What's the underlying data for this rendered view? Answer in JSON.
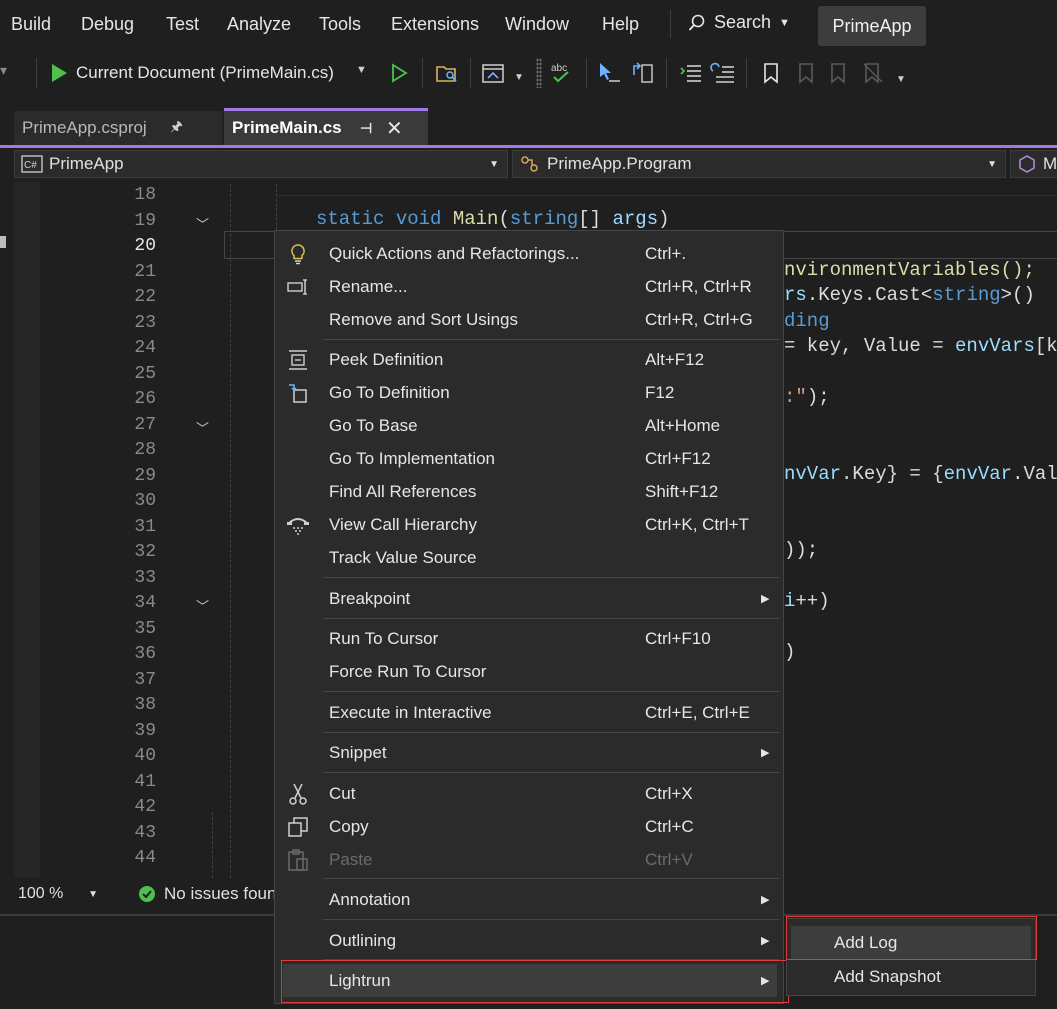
{
  "menubar": {
    "items": [
      "Build",
      "Debug",
      "Test",
      "Analyze",
      "Tools",
      "Extensions",
      "Window",
      "Help"
    ],
    "search_label": "Search",
    "solution_name": "PrimeApp"
  },
  "toolbar": {
    "run_target": "Current Document (PrimeMain.cs)"
  },
  "tabs": [
    {
      "label": "PrimeApp.csproj",
      "active": false
    },
    {
      "label": "PrimeMain.cs",
      "active": true
    }
  ],
  "navbar": {
    "project": "PrimeApp",
    "class": "PrimeApp.Program",
    "member": "M"
  },
  "editor": {
    "line_numbers": [
      "18",
      "19",
      "20",
      "21",
      "22",
      "23",
      "24",
      "25",
      "26",
      "27",
      "28",
      "29",
      "30",
      "31",
      "32",
      "33",
      "34",
      "35",
      "36",
      "37",
      "38",
      "39",
      "40",
      "41",
      "42",
      "43",
      "44"
    ],
    "current_line": "20",
    "code": {
      "l19_kw1": "static",
      "l19_kw2": "void",
      "l19_method": "Main",
      "l19_p1": "(",
      "l19_type": "string",
      "l19_p2": "[] ",
      "l19_param": "args",
      "l19_p3": ")",
      "l21": "nvironmentVariables();",
      "l22_a": "rs",
      "l22_b": ".Keys.Cast<",
      "l22_c": "string",
      "l22_d": ">()",
      "l23": "ding",
      "l24_a": "= key, Value = ",
      "l24_b": "envVars",
      "l24_c": "[k",
      "l26_a": ":\"",
      "l26_b": ");",
      "l29_a": "nvVar",
      "l29_b": ".Key} = {",
      "l29_c": "envVar",
      "l29_d": ".Val",
      "l32": "));",
      "l34_a": "i",
      "l34_b": "++)",
      "l36": ")"
    }
  },
  "status": {
    "zoom": "100 %",
    "issues": "No issues foun"
  },
  "context_menu": {
    "items": [
      {
        "label": "Quick Actions and Refactorings...",
        "shortcut": "Ctrl+.",
        "icon": "lightbulb-icon"
      },
      {
        "label": "Rename...",
        "shortcut": "Ctrl+R, Ctrl+R",
        "icon": "rename-icon"
      },
      {
        "label": "Remove and Sort Usings",
        "shortcut": "Ctrl+R, Ctrl+G"
      },
      {
        "label": "Peek Definition",
        "shortcut": "Alt+F12",
        "icon": "peek-definition-icon"
      },
      {
        "label": "Go To Definition",
        "shortcut": "F12",
        "icon": "go-to-definition-icon"
      },
      {
        "label": "Go To Base",
        "shortcut": "Alt+Home"
      },
      {
        "label": "Go To Implementation",
        "shortcut": "Ctrl+F12"
      },
      {
        "label": "Find All References",
        "shortcut": "Shift+F12"
      },
      {
        "label": "View Call Hierarchy",
        "shortcut": "Ctrl+K, Ctrl+T",
        "icon": "call-hierarchy-icon"
      },
      {
        "label": "Track Value Source",
        "shortcut": ""
      },
      {
        "label": "Breakpoint",
        "submenu": true
      },
      {
        "label": "Run To Cursor",
        "shortcut": "Ctrl+F10"
      },
      {
        "label": "Force Run To Cursor",
        "shortcut": ""
      },
      {
        "label": "Execute in Interactive",
        "shortcut": "Ctrl+E, Ctrl+E"
      },
      {
        "label": "Snippet",
        "submenu": true
      },
      {
        "label": "Cut",
        "shortcut": "Ctrl+X",
        "icon": "scissors-icon"
      },
      {
        "label": "Copy",
        "shortcut": "Ctrl+C",
        "icon": "copy-icon"
      },
      {
        "label": "Paste",
        "shortcut": "Ctrl+V",
        "icon": "paste-icon",
        "disabled": true
      },
      {
        "label": "Annotation",
        "submenu": true
      },
      {
        "label": "Outlining",
        "submenu": true
      },
      {
        "label": "Lightrun",
        "submenu": true,
        "highlighted": true
      }
    ]
  },
  "submenu": {
    "items": [
      {
        "label": "Add Log",
        "selected": true
      },
      {
        "label": "Add Snapshot"
      }
    ]
  },
  "colors": {
    "accent": "#9f79e8",
    "highlight_border": "#e03c3c",
    "run_green": "#4ec04e"
  }
}
